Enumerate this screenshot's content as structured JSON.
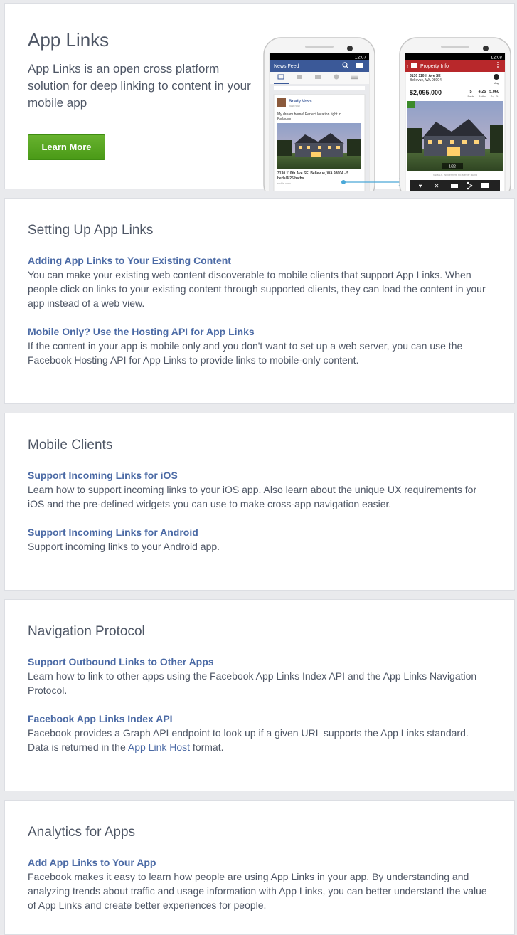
{
  "hero": {
    "title": "App Links",
    "description": "App Links is an open cross platform solution for deep linking to content in your mobile app",
    "button_label": "Learn More"
  },
  "phones": {
    "left": {
      "status_time": "12:07",
      "header_title": "News Feed",
      "post_author": "Brady Voss",
      "post_meta": "Just now",
      "post_text_1": "My dream home! Perfect location right in",
      "post_text_2": "Bellevue.",
      "link_caption_1": "3130 110th Ave SE, Bellevue, WA 98004 - 5",
      "link_caption_2": "beds/4.25 baths",
      "link_domain": "redfin.com"
    },
    "right": {
      "status_time": "12:08",
      "header_title": "Property Info",
      "address_1": "3130 110th Ave SE",
      "address_2": "Bellevue, WA 98004",
      "map_label": "Map",
      "price": "$2,095,000",
      "beds_value": "5",
      "beds_label": "Beds",
      "baths_value": "4.25",
      "baths_label": "Baths",
      "sqft_value": "5,060",
      "sqft_label": "Sq. Ft",
      "photo_counter": "1/22",
      "photo_credit": "NWMLS, Windermere RE Mercer Island"
    }
  },
  "sections": [
    {
      "title": "Setting Up App Links",
      "items": [
        {
          "title": "Adding App Links to Your Existing Content",
          "desc": "You can make your existing web content discoverable to mobile clients that support App Links. When people click on links to your existing content through supported clients, they can load the content in your app instead of a web view."
        },
        {
          "title": "Mobile Only? Use the Hosting API for App Links",
          "desc": "If the content in your app is mobile only and you don't want to set up a web server, you can use the Facebook Hosting API for App Links to provide links to mobile-only content."
        }
      ]
    },
    {
      "title": "Mobile Clients",
      "items": [
        {
          "title": "Support Incoming Links for iOS",
          "desc": "Learn how to support incoming links to your iOS app. Also learn about the unique UX requirements for iOS and the pre-defined widgets you can use to make cross-app navigation easier."
        },
        {
          "title": "Support Incoming Links for Android",
          "desc": "Support incoming links to your Android app."
        }
      ]
    },
    {
      "title": "Navigation Protocol",
      "items": [
        {
          "title": "Support Outbound Links to Other Apps",
          "desc": "Learn how to link to other apps using the Facebook App Links Index API and the App Links Navigation Protocol."
        },
        {
          "title": "Facebook App Links Index API",
          "desc_pre": "Facebook provides a Graph API endpoint to look up if a given URL supports the App Links standard. Data is returned in the ",
          "desc_link": "App Link Host",
          "desc_post": " format."
        }
      ]
    },
    {
      "title": "Analytics for Apps",
      "items": [
        {
          "title": "Add App Links to Your App",
          "desc": "Facebook makes it easy to learn how people are using App Links in your app. By understanding and analyzing trends about traffic and usage information with App Links, you can better understand the value of App Links and create better experiences for people."
        }
      ]
    }
  ],
  "colors": {
    "background": "#e9eaed",
    "link": "#4b6aa5",
    "text": "#4e5665",
    "button": "#4a9a17",
    "facebook_blue": "#3b5998",
    "property_red": "#b8282b"
  }
}
